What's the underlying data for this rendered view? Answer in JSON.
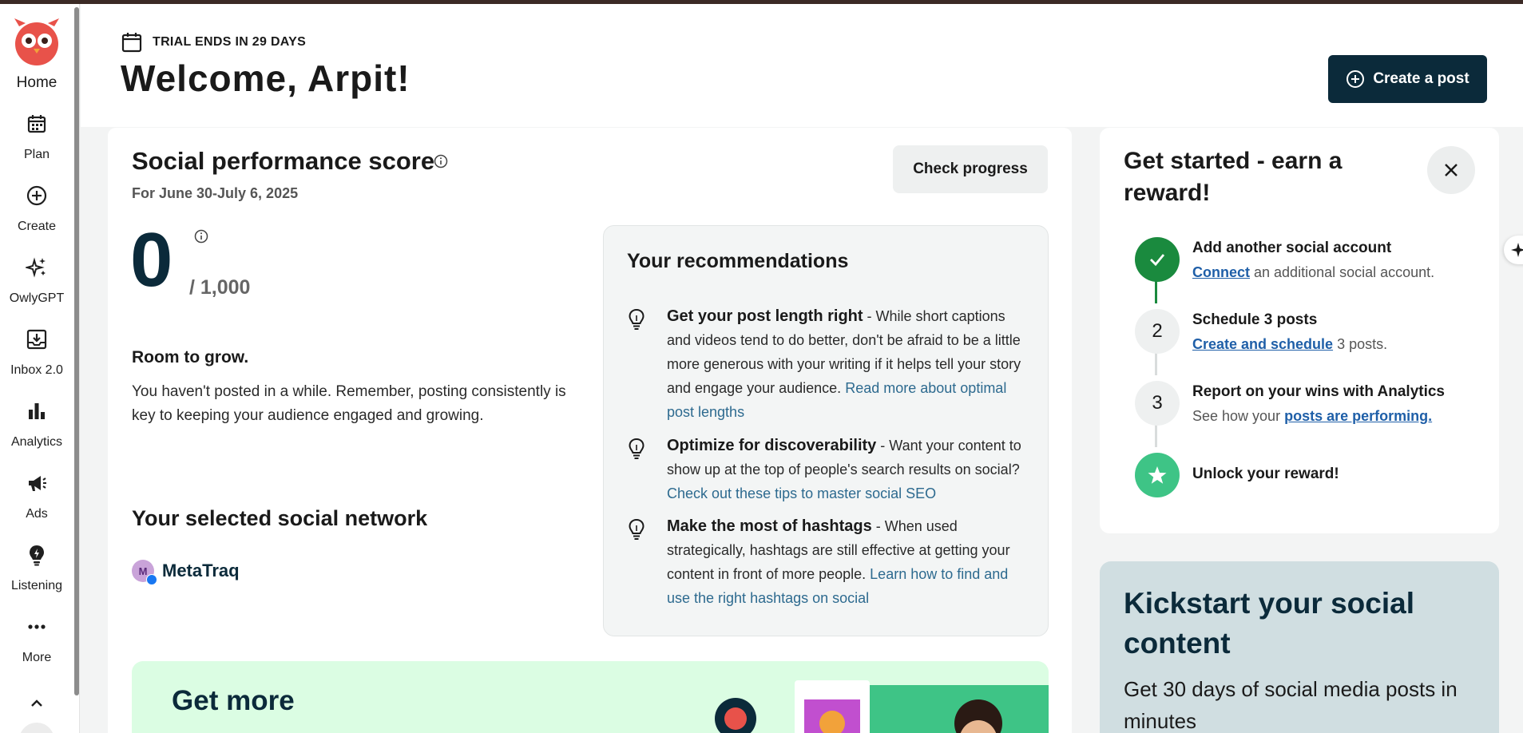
{
  "sidebar": {
    "home_label": "Home",
    "items": [
      {
        "label": "Plan",
        "icon": "calendar-icon"
      },
      {
        "label": "Create",
        "icon": "plus-circle-icon"
      },
      {
        "label": "OwlyGPT",
        "icon": "sparkles-icon"
      },
      {
        "label": "Inbox 2.0",
        "icon": "inbox-icon"
      },
      {
        "label": "Analytics",
        "icon": "bar-chart-icon"
      },
      {
        "label": "Ads",
        "icon": "megaphone-icon"
      },
      {
        "label": "Listening",
        "icon": "lightbulb-icon"
      },
      {
        "label": "More",
        "icon": "ellipsis-icon"
      }
    ]
  },
  "header": {
    "trial_text": "TRIAL ENDS IN 29 DAYS",
    "welcome": "Welcome, Arpit!",
    "create_post_label": "Create a post"
  },
  "performance": {
    "title": "Social performance score",
    "date_range": "For June 30-July 6, 2025",
    "check_progress_label": "Check progress",
    "score": "0",
    "score_max": "/ 1,000",
    "status_heading": "Room to grow.",
    "status_desc": "You haven't posted in a while. Remember, posting consistently is key to keeping your audience engaged and growing.",
    "selected_network_title": "Your selected social network",
    "network_avatar": "M",
    "network_name": "MetaTraq"
  },
  "recommendations": {
    "title": "Your recommendations",
    "items": [
      {
        "head": "Get your post length right",
        "body": "While short captions and videos tend to do better, don't be afraid to be a little more generous with your writing if it helps tell your story and engage your audience.",
        "link": "Read more about optimal post lengths"
      },
      {
        "head": "Optimize for discoverability",
        "body": "Want your content to show up at the top of people's search results on social?",
        "link": "Check out these tips to master social SEO"
      },
      {
        "head": "Make the most of hashtags",
        "body": "When used strategically, hashtags are still effective at getting your content in front of more people.",
        "link": "Learn how to find and use the right hashtags on social"
      }
    ]
  },
  "promo": {
    "title": "Get more"
  },
  "get_started": {
    "title": "Get started - earn a reward!",
    "steps": [
      {
        "num": "",
        "status": "complete",
        "head": "Add another social account",
        "link": "Connect",
        "suffix": "an additional social account.",
        "prefix": ""
      },
      {
        "num": "2",
        "status": "pending",
        "head": "Schedule 3 posts",
        "link": "Create and schedule",
        "suffix": "3 posts.",
        "prefix": ""
      },
      {
        "num": "3",
        "status": "pending",
        "head": "Report on your wins with Analytics",
        "prefix": "See how your",
        "link": "posts are performing.",
        "suffix": ""
      },
      {
        "num": "",
        "status": "reward",
        "head": "Unlock your reward!"
      }
    ]
  },
  "kickstart": {
    "title": "Kickstart your social content",
    "desc": "Get 30 days of social media posts in minutes"
  },
  "colors": {
    "brand_dark": "#0b2a3a",
    "brand_red": "#e8524a",
    "success_green": "#1a8a3e",
    "reward_green": "#3ec486",
    "link_blue": "#2d6a8f",
    "promo_bg": "#dbfde3",
    "kickstart_bg": "#d0dee1"
  }
}
